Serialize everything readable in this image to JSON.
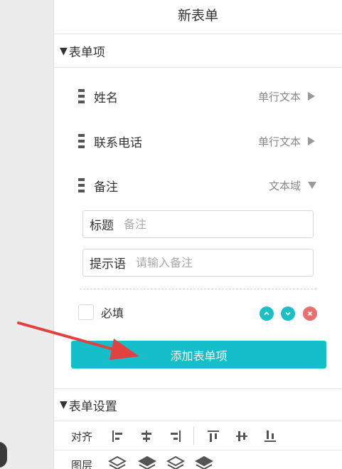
{
  "header": {
    "title": "新表单"
  },
  "form_items_section": {
    "title": "表单项"
  },
  "fields": [
    {
      "name": "姓名",
      "type": "单行文本"
    },
    {
      "name": "联系电话",
      "type": "单行文本"
    },
    {
      "name": "备注",
      "type": "文本域"
    }
  ],
  "expanded_field": {
    "title_label": "标题",
    "title_value": "备注",
    "hint_label": "提示语",
    "hint_value": "请输入备注",
    "required_label": "必填",
    "required_checked": false
  },
  "add_button": {
    "label": "添加表单项"
  },
  "settings_section": {
    "title": "表单设置",
    "align_label": "对齐",
    "layer_label": "图层"
  },
  "icons": {
    "field_collapsed": "triangle-right-icon",
    "field_expanded": "triangle-down-icon",
    "move_up": "chevron-up-icon",
    "move_down": "chevron-down-icon",
    "delete": "close-icon",
    "drag": "drag-handle-icon"
  },
  "colors": {
    "accent": "#15bfca",
    "delete": "#e8706f",
    "annotation_arrow": "#e34040"
  }
}
